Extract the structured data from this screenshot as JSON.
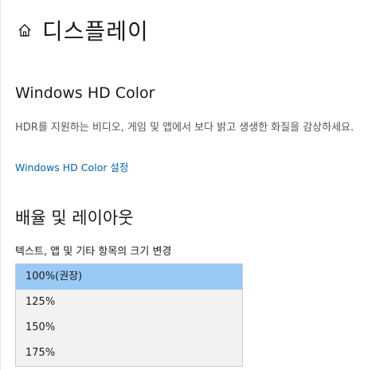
{
  "header": {
    "title": "디스플레이",
    "icon": "home-icon"
  },
  "hdr_section": {
    "title": "Windows HD Color",
    "description": "HDR를 지원하는 비디오, 게임 및 앱에서 보다 밝고 생생한 화질을 감상하세요.",
    "link_label": "Windows HD Color 설정"
  },
  "layout_section": {
    "title": "배율 및 레이아웃",
    "scale_label": "텍스트, 앱 및 기타 항목의 크기 변경",
    "scale_options": [
      {
        "label": "100%(권장)",
        "selected": true
      },
      {
        "label": "125%",
        "selected": false
      },
      {
        "label": "150%",
        "selected": false
      },
      {
        "label": "175%",
        "selected": false
      }
    ]
  },
  "colors": {
    "link": "#0063b1",
    "selected_option": "#99c9f5",
    "dropdown_bg": "#f2f2f2"
  }
}
